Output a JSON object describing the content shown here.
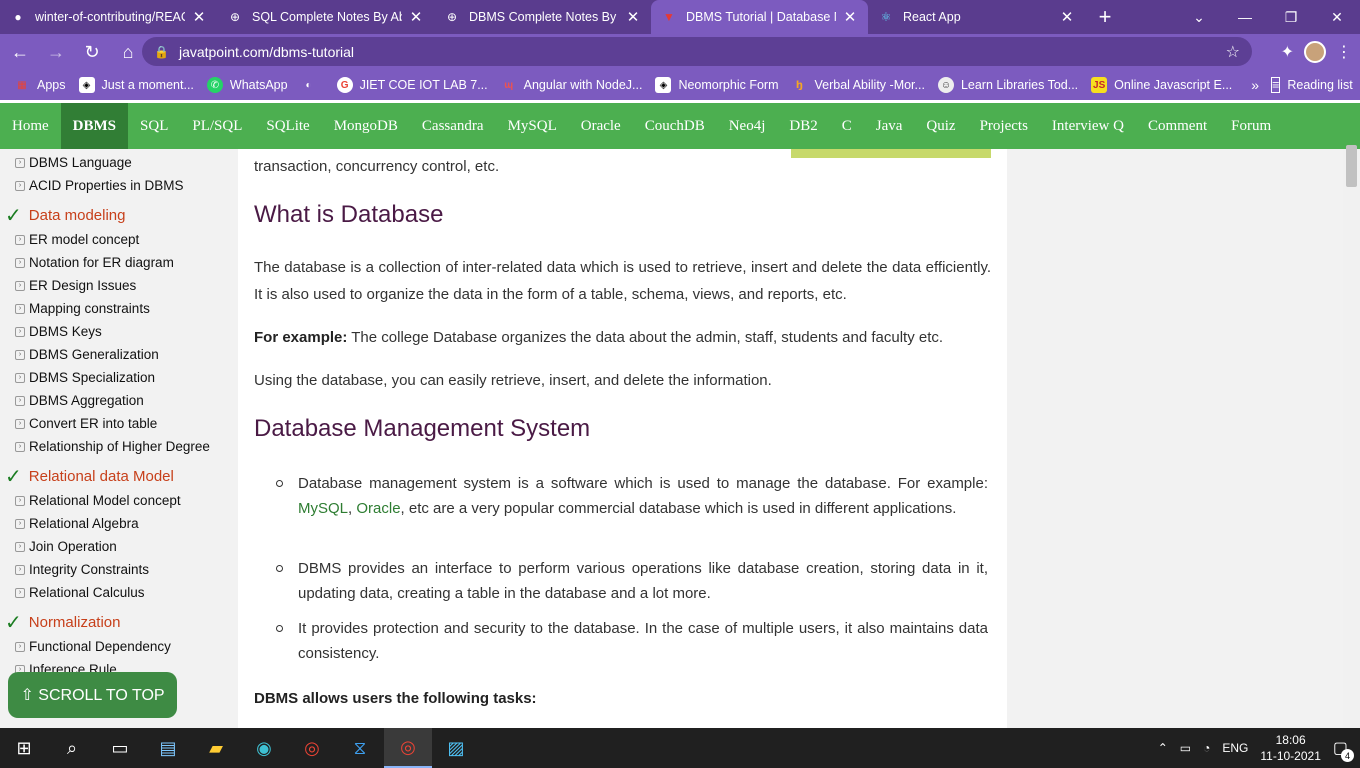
{
  "browser": {
    "tabs": [
      {
        "title": "winter-of-contributing/REAC",
        "icon": "github-icon"
      },
      {
        "title": "SQL Complete Notes By Abh",
        "icon": "globe-icon"
      },
      {
        "title": "DBMS Complete Notes By Al",
        "icon": "globe-icon"
      },
      {
        "title": "DBMS Tutorial | Database M",
        "icon": "javatpoint-icon",
        "active": true
      },
      {
        "title": "React App",
        "icon": "react-icon"
      }
    ],
    "url": "javatpoint.com/dbms-tutorial",
    "bookmarks": [
      "Apps",
      "Just a moment...",
      "WhatsApp",
      "",
      "JIET COE IOT LAB 7...",
      "Angular with NodeJ...",
      "Neomorphic Form",
      "Verbal Ability -Mor...",
      "Learn Libraries Tod...",
      "Online Javascript E..."
    ],
    "reading_list": "Reading list"
  },
  "sitenav": [
    "Home",
    "DBMS",
    "SQL",
    "PL/SQL",
    "SQLite",
    "MongoDB",
    "Cassandra",
    "MySQL",
    "Oracle",
    "CouchDB",
    "Neo4j",
    "DB2",
    "C",
    "Java",
    "Quiz",
    "Projects",
    "Interview Q",
    "Comment",
    "Forum"
  ],
  "sidebar": {
    "items_top": [
      "DBMS Language",
      "ACID Properties in DBMS"
    ],
    "section1": "Data modeling",
    "items1": [
      "ER model concept",
      "Notation for ER diagram",
      "ER Design Issues",
      "Mapping constraints",
      "DBMS Keys",
      "DBMS Generalization",
      "DBMS Specialization",
      "DBMS Aggregation",
      "Convert ER into table",
      "Relationship of Higher Degree"
    ],
    "section2": "Relational data Model",
    "items2": [
      "Relational Model concept",
      "Relational Algebra",
      "Join Operation",
      "Integrity Constraints",
      "Relational Calculus"
    ],
    "section3": "Normalization",
    "items3": [
      "Functional Dependency",
      "Inference Rule"
    ],
    "scroll_to_top": "⇧ SCROLL TO TOP"
  },
  "content": {
    "intro_tail": "transaction, concurrency control, etc.",
    "h_database": "What is Database",
    "p1": "The database is a collection of inter-related data which is used to retrieve, insert and delete the data efficiently. It is also used to organize the data in the form of a table, schema, views, and reports, etc.",
    "example_label": "For example:",
    "example_text": " The college Database organizes the data about the admin, staff, students and faculty etc.",
    "p3": "Using the database, you can easily retrieve, insert, and delete the information.",
    "h_dbms": "Database Management System",
    "li1_a": "Database management system is a software which is used to manage the database. For example: ",
    "li1_link1": "MySQL",
    "li1_sep": ", ",
    "li1_link2": "Oracle",
    "li1_b": ", etc are a very popular commercial database which is used in different applications.",
    "li2": "DBMS provides an interface to perform various operations like database creation, storing data in it, updating data, creating a table in the database and a lot more.",
    "li3": "It provides protection and security to the database. In the case of multiple users, it also maintains data consistency.",
    "tasks_heading": "DBMS allows users the following tasks:"
  },
  "taskbar": {
    "lang": "ENG",
    "time": "18:06",
    "date": "11-10-2021",
    "notifications": "4"
  }
}
